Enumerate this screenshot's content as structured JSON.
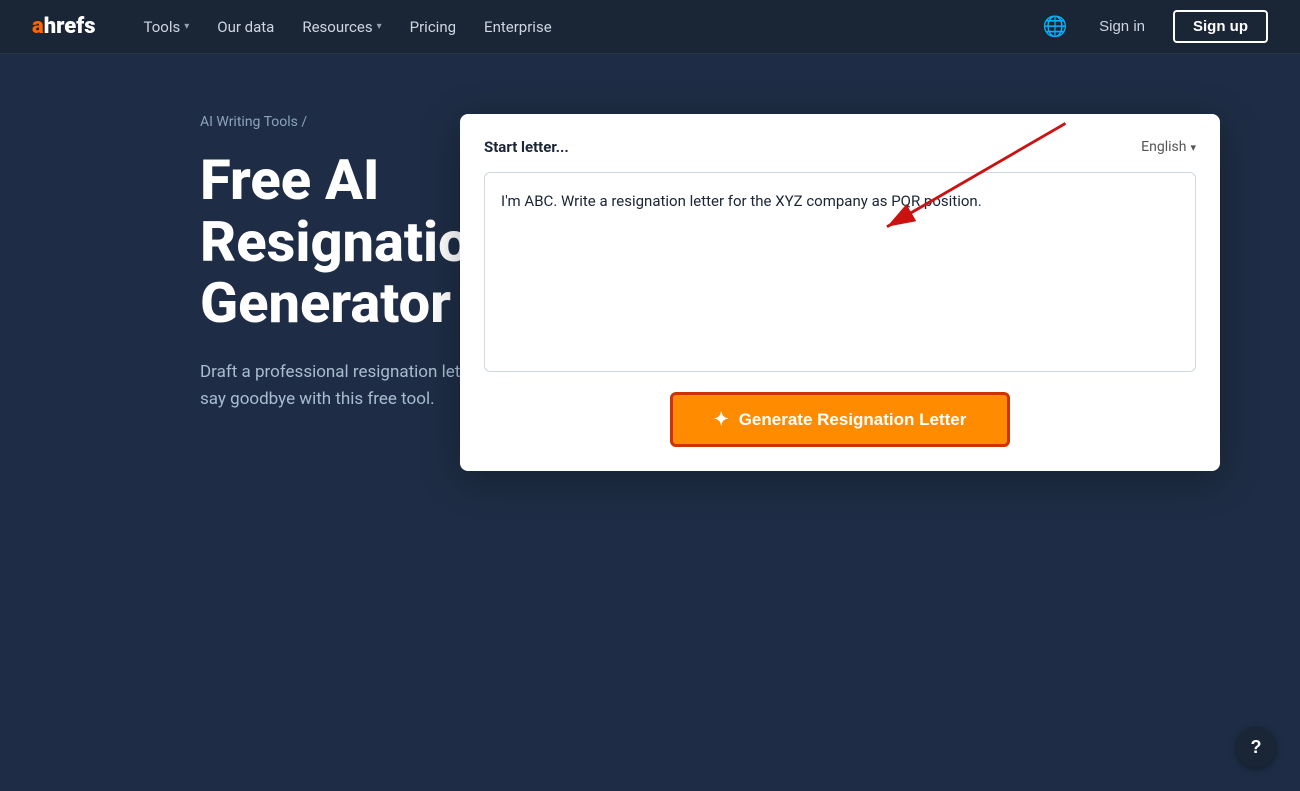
{
  "navbar": {
    "logo_a": "a",
    "logo_hrefs": "hrefs",
    "nav_items": [
      {
        "label": "Tools",
        "has_dropdown": true
      },
      {
        "label": "Our data",
        "has_dropdown": false
      },
      {
        "label": "Resources",
        "has_dropdown": true
      },
      {
        "label": "Pricing",
        "has_dropdown": false
      },
      {
        "label": "Enterprise",
        "has_dropdown": false
      }
    ],
    "globe_label": "🌐",
    "signin_label": "Sign in",
    "signup_label": "Sign up"
  },
  "breadcrumb": {
    "parent": "AI Writing Tools",
    "separator": "/"
  },
  "hero": {
    "title": "Free AI Resignation Letter Generator",
    "description": "Draft a professional resignation letter to gracefully say goodbye with this free tool."
  },
  "tool": {
    "card_label": "Start letter...",
    "language_label": "English",
    "textarea_value": "I'm ABC. Write a resignation letter for the XYZ company as PQR position.",
    "generate_button_label": "Generate Resignation Letter",
    "sparkle_icon": "✦"
  },
  "help_button": "?"
}
